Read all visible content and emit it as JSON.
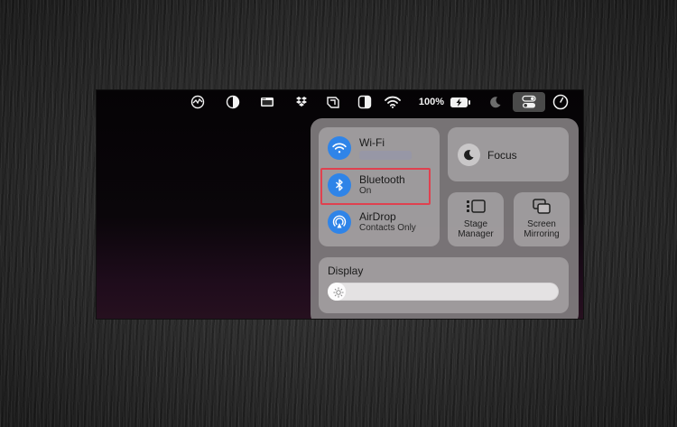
{
  "menubar": {
    "battery_percent": "100%",
    "icons": [
      "activity-monitor-icon",
      "contrast-icon",
      "window-icon",
      "dropbox-icon",
      "night-shift-icon",
      "display-mode-icon",
      "wifi-icon",
      "battery-charging-icon",
      "moon-icon",
      "control-center-icon",
      "clock-icon"
    ]
  },
  "control_center": {
    "wifi": {
      "title": "Wi-Fi",
      "subtitle": ""
    },
    "bluetooth": {
      "title": "Bluetooth",
      "subtitle": "On"
    },
    "airdrop": {
      "title": "AirDrop",
      "subtitle": "Contacts Only"
    },
    "focus": {
      "label": "Focus"
    },
    "stage_manager": {
      "label": "Stage Manager",
      "line1": "Stage",
      "line2": "Manager"
    },
    "screen_mirroring": {
      "label": "Screen Mirroring",
      "line1": "Screen",
      "line2": "Mirroring"
    },
    "display": {
      "label": "Display",
      "brightness": 0.05
    }
  },
  "colors": {
    "accent_blue": "#2f84e8",
    "highlight_red": "#e0414f"
  }
}
